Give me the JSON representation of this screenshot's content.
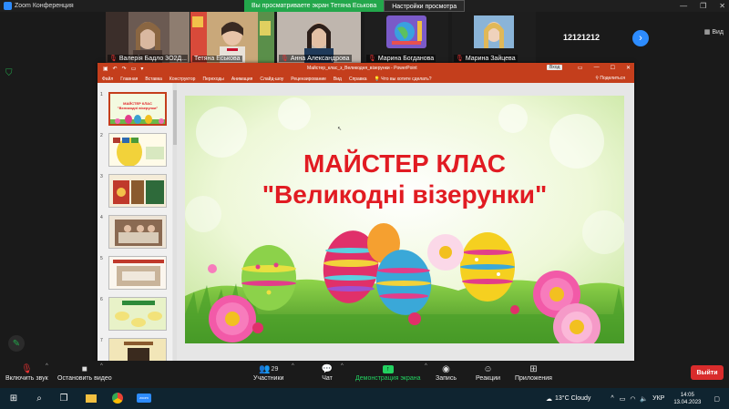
{
  "zoom": {
    "window_title": "Zoom Конференция",
    "share_banner": "Вы просматриваете экран Тетяна Еськова",
    "view_settings": "Настройки просмотра",
    "view_label": "Вид",
    "participants_overflow": "1212",
    "participants": [
      {
        "name": "Валерія Бадло 3О2Д...",
        "muted": true
      },
      {
        "name": "Тетяна Еськова",
        "muted": false
      },
      {
        "name": "Анна Александрова",
        "muted": true
      },
      {
        "name": "Марина Богданова",
        "muted": true
      },
      {
        "name": "Марина Зайцева",
        "muted": true
      },
      {
        "name": "1212",
        "muted": false
      }
    ]
  },
  "ppt": {
    "document_title": "Майстер_клас_з_Великодня_візерунки  -  PowerPoint",
    "signin": "Вход",
    "ribbon_tabs": [
      "Файл",
      "Главная",
      "Вставка",
      "Конструктор",
      "Переходы",
      "Анимация",
      "Слайд-шоу",
      "Рецензирование",
      "Вид",
      "Справка"
    ],
    "tell_me": "Что вы хотите сделать?",
    "share": "Поделиться",
    "thumb_numbers": [
      "1",
      "2",
      "3",
      "4",
      "5",
      "6",
      "7"
    ],
    "thumb1_title": "МАЙСТЕР КЛАС",
    "thumb1_sub": "\"Великодні візерунки\"",
    "slide": {
      "title": "МАЙСТЕР КЛАС",
      "subtitle": "\"Великодні візерунки\""
    }
  },
  "toolbar": {
    "audio": "Включить звук",
    "video": "Остановить видео",
    "participants": "Участники",
    "participants_count": "29",
    "chat": "Чат",
    "share": "Демонстрация экрана",
    "record": "Запись",
    "reactions": "Реакции",
    "apps": "Приложения",
    "leave": "Выйти"
  },
  "taskbar": {
    "weather": "13°C  Cloudy",
    "lang": "УКР",
    "time": "14:05",
    "date": "13.04.2023"
  },
  "colors": {
    "ppt_accent": "#c43e1c",
    "zoom_blue": "#2d8cff",
    "share_green": "#23a74b",
    "slide_title": "#e11b22",
    "leave_red": "#d92c2c"
  }
}
